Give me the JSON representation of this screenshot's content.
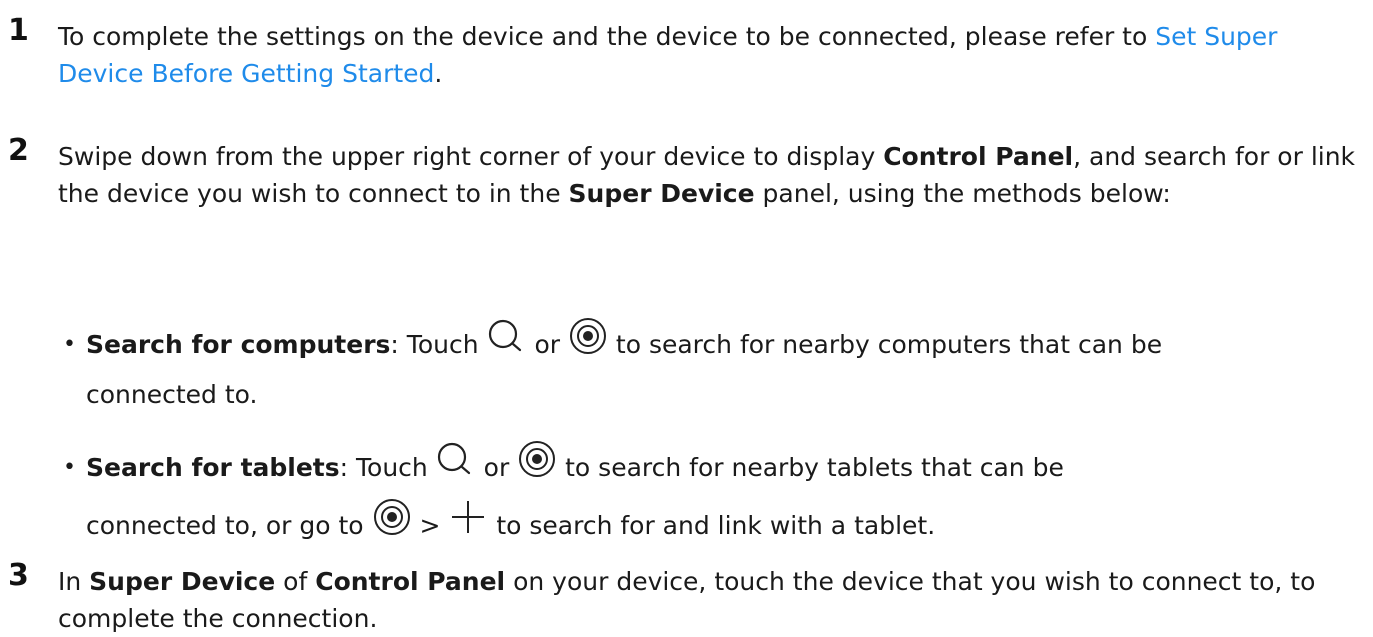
{
  "steps": [
    {
      "number": "1",
      "text_before": "To complete the settings on the device and the device to be connected, please refer to ",
      "link_text": "Set Super Device Before Getting Started",
      "text_after": "."
    },
    {
      "number": "2",
      "text_1": "Swipe down from the upper right corner of your device to display ",
      "bold_1": "Control Panel",
      "text_2": ", and search for or link the device you wish to connect to in the ",
      "bold_2": "Super Device",
      "text_3": " panel, using the methods below:"
    },
    {
      "number": "3",
      "text_1": "In ",
      "bold_1": "Super Device",
      "text_2": " of ",
      "bold_2": "Control Panel",
      "text_3": " on your device, touch the device that you wish to connect to, to complete the connection."
    }
  ],
  "bullets": [
    {
      "dot": "•",
      "title": "Search for computers",
      "touch": ": Touch ",
      "or": " or ",
      "rest": " to search for nearby computers that can be",
      "cont": "connected to."
    },
    {
      "dot": "•",
      "title": "Search for tablets",
      "touch": ": Touch ",
      "or": " or ",
      "rest": " to search for nearby tablets that can be",
      "cont_1": "connected to, or go to ",
      "gt": " > ",
      "cont_2": " to search for and link with a tablet."
    }
  ],
  "icons": {
    "search": "search-icon",
    "radar": "nearby-scan-icon",
    "add": "plus-icon"
  }
}
